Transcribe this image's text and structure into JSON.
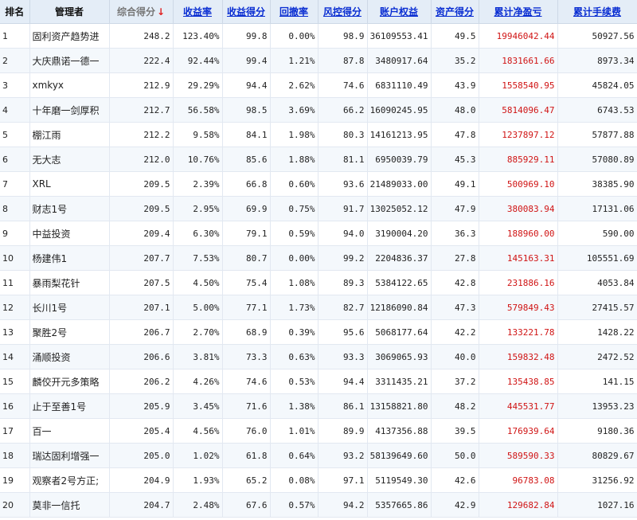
{
  "headers": {
    "rank": "排名",
    "manager": "管理者",
    "total_score": "综合得分",
    "sort_arrow": "↓",
    "return_rate": "收益率",
    "return_score": "收益得分",
    "drawdown": "回撤率",
    "risk_score": "风控得分",
    "equity": "账户权益",
    "asset_score": "资产得分",
    "cum_pnl": "累计净盈亏",
    "cum_fee": "累计手续费"
  },
  "colors": {
    "header_bg": "#e4edf7",
    "link": "#0a2ed2",
    "loss_profit": "#d01414",
    "sort_arrow": "#e02020"
  },
  "rows": [
    [
      "1",
      "固利资产趋势进",
      "248.2",
      "123.40%",
      "99.8",
      "0.00%",
      "98.9",
      "36109553.41",
      "49.5",
      "19946042.44",
      "50927.56"
    ],
    [
      "2",
      "大庆鼎诺一德一",
      "222.4",
      "92.44%",
      "99.4",
      "1.21%",
      "87.8",
      "3480917.64",
      "35.2",
      "1831661.66",
      "8973.34"
    ],
    [
      "3",
      "xmkyx",
      "212.9",
      "29.29%",
      "94.4",
      "2.62%",
      "74.6",
      "6831110.49",
      "43.9",
      "1558540.95",
      "45824.05"
    ],
    [
      "4",
      "十年磨一剑厚积",
      "212.7",
      "56.58%",
      "98.5",
      "3.69%",
      "66.2",
      "16090245.95",
      "48.0",
      "5814096.47",
      "6743.53"
    ],
    [
      "5",
      "棚江雨",
      "212.2",
      "9.58%",
      "84.1",
      "1.98%",
      "80.3",
      "14161213.95",
      "47.8",
      "1237897.12",
      "57877.88"
    ],
    [
      "6",
      "无大志",
      "212.0",
      "10.76%",
      "85.6",
      "1.88%",
      "81.1",
      "6950039.79",
      "45.3",
      "885929.11",
      "57080.89"
    ],
    [
      "7",
      "XRL",
      "209.5",
      "2.39%",
      "66.8",
      "0.60%",
      "93.6",
      "21489033.00",
      "49.1",
      "500969.10",
      "38385.90"
    ],
    [
      "8",
      "财志1号",
      "209.5",
      "2.95%",
      "69.9",
      "0.75%",
      "91.7",
      "13025052.12",
      "47.9",
      "380083.94",
      "17131.06"
    ],
    [
      "9",
      "中益投资",
      "209.4",
      "6.30%",
      "79.1",
      "0.59%",
      "94.0",
      "3190004.20",
      "36.3",
      "188960.00",
      "590.00"
    ],
    [
      "10",
      "杨建伟1",
      "207.7",
      "7.53%",
      "80.7",
      "0.00%",
      "99.2",
      "2204836.37",
      "27.8",
      "145163.31",
      "105551.69"
    ],
    [
      "11",
      "暴雨梨花针",
      "207.5",
      "4.50%",
      "75.4",
      "1.08%",
      "89.3",
      "5384122.65",
      "42.8",
      "231886.16",
      "4053.84"
    ],
    [
      "12",
      "长川1号",
      "207.1",
      "5.00%",
      "77.1",
      "1.73%",
      "82.7",
      "12186090.84",
      "47.3",
      "579849.43",
      "27415.57"
    ],
    [
      "13",
      "聚胜2号",
      "206.7",
      "2.70%",
      "68.9",
      "0.39%",
      "95.6",
      "5068177.64",
      "42.2",
      "133221.78",
      "1428.22"
    ],
    [
      "14",
      "涌顺投资",
      "206.6",
      "3.81%",
      "73.3",
      "0.63%",
      "93.3",
      "3069065.93",
      "40.0",
      "159832.48",
      "2472.52"
    ],
    [
      "15",
      "麟佼开元多策略",
      "206.2",
      "4.26%",
      "74.6",
      "0.53%",
      "94.4",
      "3311435.21",
      "37.2",
      "135438.85",
      "141.15"
    ],
    [
      "16",
      "止于至善1号",
      "205.9",
      "3.45%",
      "71.6",
      "1.38%",
      "86.1",
      "13158821.80",
      "48.2",
      "445531.77",
      "13953.23"
    ],
    [
      "17",
      "百一",
      "205.4",
      "4.56%",
      "76.0",
      "1.01%",
      "89.9",
      "4137356.88",
      "39.5",
      "176939.64",
      "9180.36"
    ],
    [
      "18",
      "瑞达固利增强一",
      "205.0",
      "1.02%",
      "61.8",
      "0.64%",
      "93.2",
      "58139649.60",
      "50.0",
      "589590.33",
      "80829.67"
    ],
    [
      "19",
      "观察者2号方正;",
      "204.9",
      "1.93%",
      "65.2",
      "0.08%",
      "97.1",
      "5119549.30",
      "42.6",
      "96783.08",
      "31256.92"
    ],
    [
      "20",
      "莫非一信托",
      "204.7",
      "2.48%",
      "67.6",
      "0.57%",
      "94.2",
      "5357665.86",
      "42.9",
      "129682.84",
      "1027.16"
    ]
  ]
}
